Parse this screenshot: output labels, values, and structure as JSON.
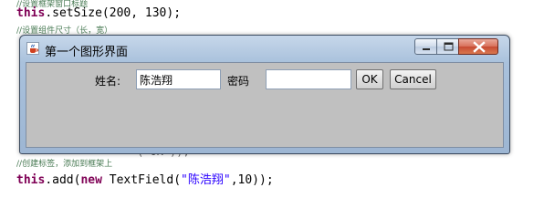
{
  "editor": {
    "comment1": "//设置框架窗口标题",
    "line1": "this.setSize(200, 130);",
    "comment2": "//设置组件尺寸（长，宽）",
    "comment3": "//创建标签，添加到框架上",
    "line3_prefix": "this.add(new TextField(",
    "line3_string": "\"陈浩翔\"",
    "line3_suffix": ",10));",
    "partial_text": "(\"OK\"));"
  },
  "window": {
    "title": "第一个图形界面",
    "controls": {
      "minimize": "minimize",
      "maximize": "maximize",
      "close": "close"
    }
  },
  "form": {
    "name_label": "姓名:",
    "name_value": "陈浩翔",
    "password_label": "密码",
    "password_value": "",
    "ok_label": "OK",
    "cancel_label": "Cancel"
  },
  "colors": {
    "client_bg": "#c0c0c0",
    "titlebar": "#a9c1dc",
    "close_button": "#c74a33"
  }
}
